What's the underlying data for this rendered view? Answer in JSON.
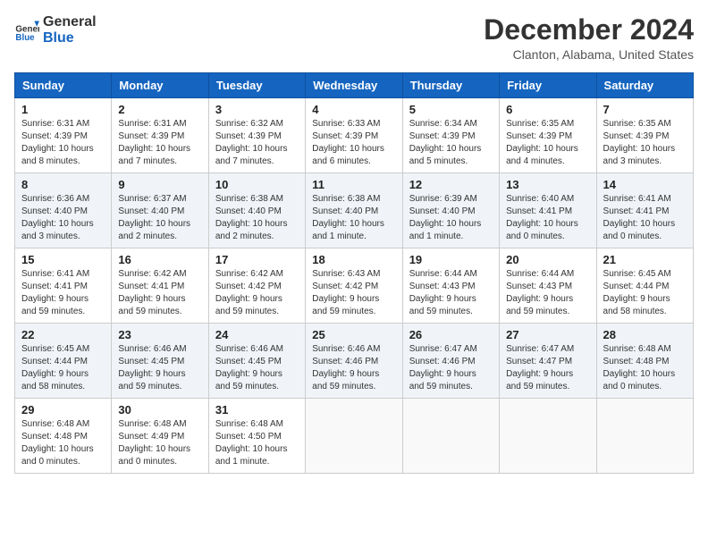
{
  "header": {
    "logo_line1": "General",
    "logo_line2": "Blue",
    "month": "December 2024",
    "location": "Clanton, Alabama, United States"
  },
  "days_of_week": [
    "Sunday",
    "Monday",
    "Tuesday",
    "Wednesday",
    "Thursday",
    "Friday",
    "Saturday"
  ],
  "weeks": [
    [
      {
        "day": "1",
        "sunrise": "6:31 AM",
        "sunset": "4:39 PM",
        "daylight": "10 hours and 8 minutes."
      },
      {
        "day": "2",
        "sunrise": "6:31 AM",
        "sunset": "4:39 PM",
        "daylight": "10 hours and 7 minutes."
      },
      {
        "day": "3",
        "sunrise": "6:32 AM",
        "sunset": "4:39 PM",
        "daylight": "10 hours and 7 minutes."
      },
      {
        "day": "4",
        "sunrise": "6:33 AM",
        "sunset": "4:39 PM",
        "daylight": "10 hours and 6 minutes."
      },
      {
        "day": "5",
        "sunrise": "6:34 AM",
        "sunset": "4:39 PM",
        "daylight": "10 hours and 5 minutes."
      },
      {
        "day": "6",
        "sunrise": "6:35 AM",
        "sunset": "4:39 PM",
        "daylight": "10 hours and 4 minutes."
      },
      {
        "day": "7",
        "sunrise": "6:35 AM",
        "sunset": "4:39 PM",
        "daylight": "10 hours and 3 minutes."
      }
    ],
    [
      {
        "day": "8",
        "sunrise": "6:36 AM",
        "sunset": "4:40 PM",
        "daylight": "10 hours and 3 minutes."
      },
      {
        "day": "9",
        "sunrise": "6:37 AM",
        "sunset": "4:40 PM",
        "daylight": "10 hours and 2 minutes."
      },
      {
        "day": "10",
        "sunrise": "6:38 AM",
        "sunset": "4:40 PM",
        "daylight": "10 hours and 2 minutes."
      },
      {
        "day": "11",
        "sunrise": "6:38 AM",
        "sunset": "4:40 PM",
        "daylight": "10 hours and 1 minute."
      },
      {
        "day": "12",
        "sunrise": "6:39 AM",
        "sunset": "4:40 PM",
        "daylight": "10 hours and 1 minute."
      },
      {
        "day": "13",
        "sunrise": "6:40 AM",
        "sunset": "4:41 PM",
        "daylight": "10 hours and 0 minutes."
      },
      {
        "day": "14",
        "sunrise": "6:41 AM",
        "sunset": "4:41 PM",
        "daylight": "10 hours and 0 minutes."
      }
    ],
    [
      {
        "day": "15",
        "sunrise": "6:41 AM",
        "sunset": "4:41 PM",
        "daylight": "9 hours and 59 minutes."
      },
      {
        "day": "16",
        "sunrise": "6:42 AM",
        "sunset": "4:41 PM",
        "daylight": "9 hours and 59 minutes."
      },
      {
        "day": "17",
        "sunrise": "6:42 AM",
        "sunset": "4:42 PM",
        "daylight": "9 hours and 59 minutes."
      },
      {
        "day": "18",
        "sunrise": "6:43 AM",
        "sunset": "4:42 PM",
        "daylight": "9 hours and 59 minutes."
      },
      {
        "day": "19",
        "sunrise": "6:44 AM",
        "sunset": "4:43 PM",
        "daylight": "9 hours and 59 minutes."
      },
      {
        "day": "20",
        "sunrise": "6:44 AM",
        "sunset": "4:43 PM",
        "daylight": "9 hours and 59 minutes."
      },
      {
        "day": "21",
        "sunrise": "6:45 AM",
        "sunset": "4:44 PM",
        "daylight": "9 hours and 58 minutes."
      }
    ],
    [
      {
        "day": "22",
        "sunrise": "6:45 AM",
        "sunset": "4:44 PM",
        "daylight": "9 hours and 58 minutes."
      },
      {
        "day": "23",
        "sunrise": "6:46 AM",
        "sunset": "4:45 PM",
        "daylight": "9 hours and 59 minutes."
      },
      {
        "day": "24",
        "sunrise": "6:46 AM",
        "sunset": "4:45 PM",
        "daylight": "9 hours and 59 minutes."
      },
      {
        "day": "25",
        "sunrise": "6:46 AM",
        "sunset": "4:46 PM",
        "daylight": "9 hours and 59 minutes."
      },
      {
        "day": "26",
        "sunrise": "6:47 AM",
        "sunset": "4:46 PM",
        "daylight": "9 hours and 59 minutes."
      },
      {
        "day": "27",
        "sunrise": "6:47 AM",
        "sunset": "4:47 PM",
        "daylight": "9 hours and 59 minutes."
      },
      {
        "day": "28",
        "sunrise": "6:48 AM",
        "sunset": "4:48 PM",
        "daylight": "10 hours and 0 minutes."
      }
    ],
    [
      {
        "day": "29",
        "sunrise": "6:48 AM",
        "sunset": "4:48 PM",
        "daylight": "10 hours and 0 minutes."
      },
      {
        "day": "30",
        "sunrise": "6:48 AM",
        "sunset": "4:49 PM",
        "daylight": "10 hours and 0 minutes."
      },
      {
        "day": "31",
        "sunrise": "6:48 AM",
        "sunset": "4:50 PM",
        "daylight": "10 hours and 1 minute."
      },
      null,
      null,
      null,
      null
    ]
  ],
  "labels": {
    "sunrise": "Sunrise:",
    "sunset": "Sunset:",
    "daylight": "Daylight:"
  }
}
